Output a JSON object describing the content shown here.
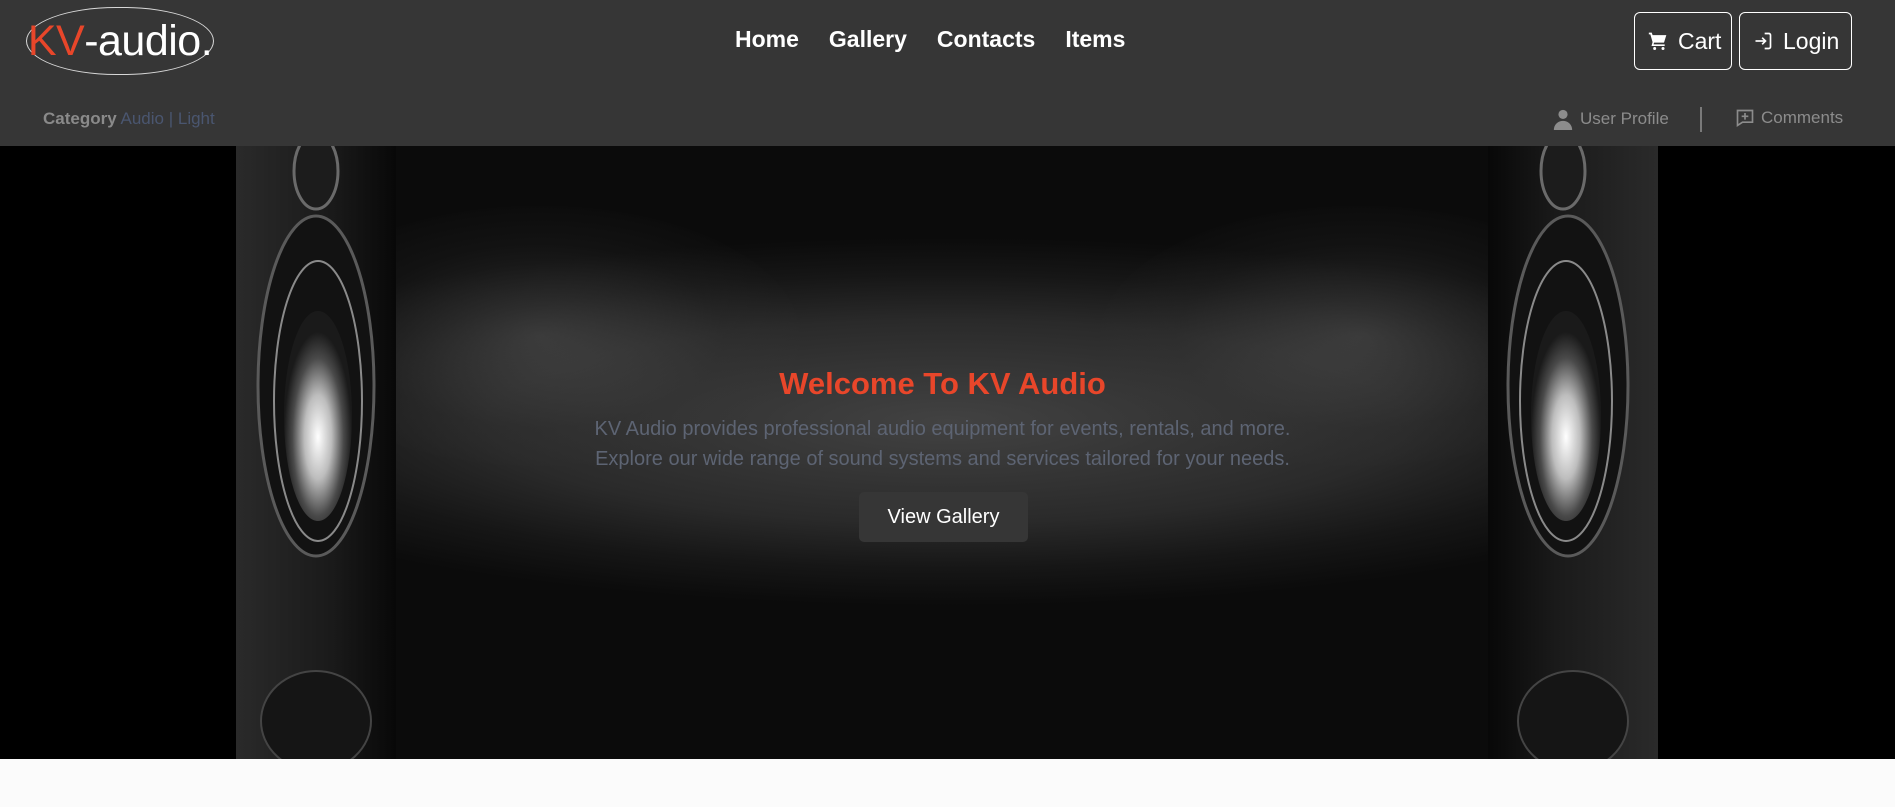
{
  "logo": {
    "kv": "KV",
    "rest": "-audio."
  },
  "nav": {
    "home": "Home",
    "gallery": "Gallery",
    "contacts": "Contacts",
    "items": "Items"
  },
  "header_buttons": {
    "cart": {
      "label": "Cart",
      "icon": "cart-icon"
    },
    "login": {
      "label": "Login",
      "icon": "login-icon"
    }
  },
  "category": {
    "label": "Category",
    "options": [
      "Audio",
      "Light"
    ],
    "separator": "|"
  },
  "utility": {
    "user_profile": {
      "label": "User Profile",
      "icon": "user-icon"
    },
    "comments": {
      "label": "Comments",
      "icon": "comment-icon"
    }
  },
  "hero": {
    "title": "Welcome To KV Audio",
    "description_line1": "KV Audio provides professional audio equipment for events, rentals, and more.",
    "description_line2": "Explore our wide range of sound systems and services tailored for your needs.",
    "button": "View Gallery"
  },
  "colors": {
    "accent": "#e8462a",
    "header_bg": "#363636",
    "category_link": "#4a5670"
  }
}
